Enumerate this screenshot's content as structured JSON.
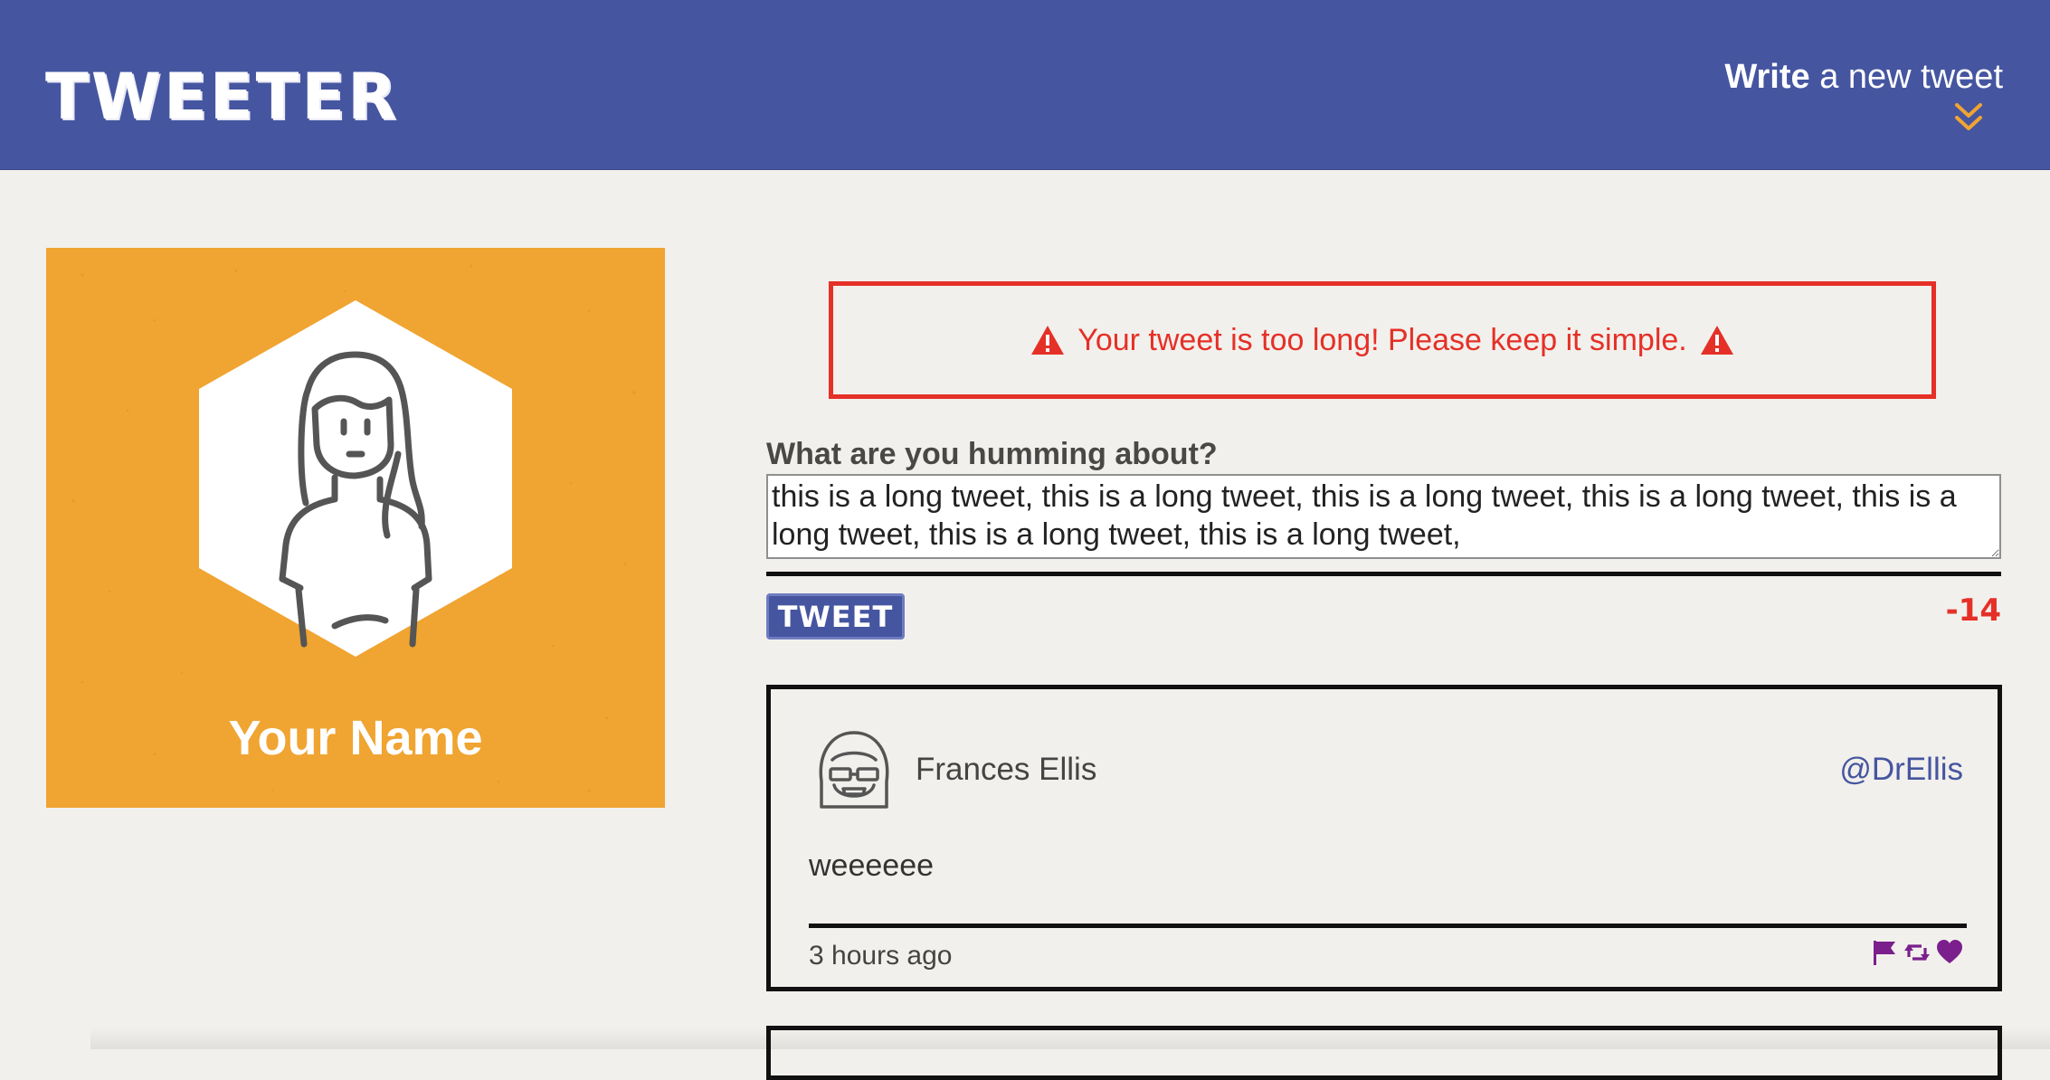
{
  "header": {
    "logo_text": "TWEETER",
    "compose_toggle": {
      "bold_word": "Write",
      "rest": " a new tweet",
      "icon": "double-chevron-down-icon"
    },
    "colors": {
      "nav_background": "#4555a0",
      "chevron_accent": "#f0a431"
    }
  },
  "profile": {
    "name": "Your Name",
    "avatar_icon": "user-avatar-icon",
    "background_color": "#f0a431"
  },
  "error": {
    "message": "Your tweet is too long! Please keep it simple.",
    "icon": "warning-triangle-icon",
    "color": "#e53027"
  },
  "compose": {
    "question": "What are you humming about?",
    "textarea_value": "this is a long tweet, this is a long tweet, this is a long tweet, this is a long tweet, this is a long tweet, this is a long tweet, this is a long tweet,",
    "button_label": "TWEET",
    "counter": "-14"
  },
  "tweets": [
    {
      "author": "Frances Ellis",
      "handle": "@DrEllis",
      "content": "weeeeee",
      "time": "3 hours ago",
      "actions": [
        "flag-icon",
        "retweet-icon",
        "heart-icon"
      ],
      "action_color": "#7a1f8c"
    }
  ]
}
